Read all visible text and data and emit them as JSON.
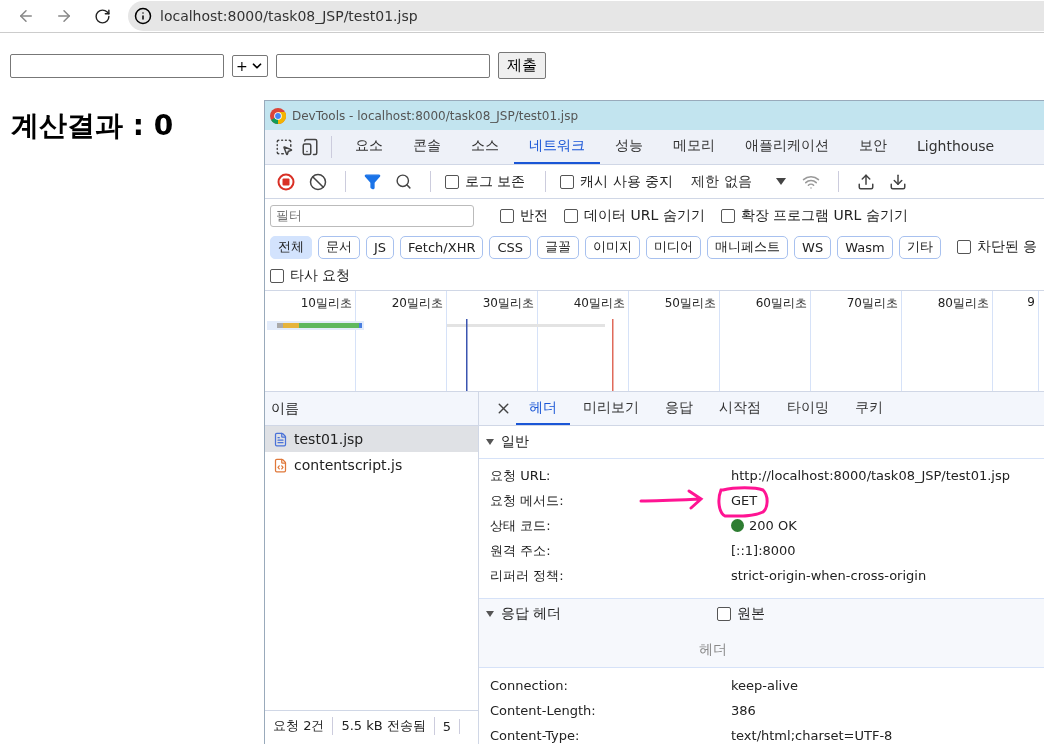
{
  "browser": {
    "url": "localhost:8000/task08_JSP/test01.jsp"
  },
  "form": {
    "operator": "+",
    "submit": "제출"
  },
  "result": "계산결과 : 0",
  "devtools": {
    "title": "DevTools - localhost:8000/task08_JSP/test01.jsp",
    "tabs": [
      {
        "label": "요소",
        "selected": false
      },
      {
        "label": "콘솔",
        "selected": false
      },
      {
        "label": "소스",
        "selected": false
      },
      {
        "label": "네트워크",
        "selected": true
      },
      {
        "label": "성능",
        "selected": false
      },
      {
        "label": "메모리",
        "selected": false
      },
      {
        "label": "애플리케이션",
        "selected": false
      },
      {
        "label": "보안",
        "selected": false
      },
      {
        "label": "Lighthouse",
        "selected": false
      }
    ],
    "toolbar": {
      "checks": [
        {
          "label": "로그 보존",
          "checked": false
        },
        {
          "label": "캐시 사용 중지",
          "checked": false
        }
      ],
      "throttle": "제한 없음"
    },
    "filter": {
      "placeholder": "필터",
      "checks": [
        {
          "label": "반전",
          "checked": false
        },
        {
          "label": "데이터 URL 숨기기",
          "checked": false
        },
        {
          "label": "확장 프로그램 URL 숨기기",
          "checked": false
        }
      ]
    },
    "types": [
      {
        "label": "전체",
        "selected": true
      },
      {
        "label": "문서",
        "selected": false
      },
      {
        "label": "JS",
        "selected": false
      },
      {
        "label": "Fetch/XHR",
        "selected": false
      },
      {
        "label": "CSS",
        "selected": false
      },
      {
        "label": "글꼴",
        "selected": false
      },
      {
        "label": "이미지",
        "selected": false
      },
      {
        "label": "미디어",
        "selected": false
      },
      {
        "label": "매니페스트",
        "selected": false
      },
      {
        "label": "WS",
        "selected": false
      },
      {
        "label": "Wasm",
        "selected": false
      },
      {
        "label": "기타",
        "selected": false
      }
    ],
    "blocked": {
      "label": "차단된 응",
      "checked": false
    },
    "third_party": {
      "label": "타사 요청",
      "checked": false
    },
    "timeline": {
      "ticks": [
        "10밀리초",
        "20밀리초",
        "30밀리초",
        "40밀리초",
        "50밀리초",
        "60밀리초",
        "70밀리초",
        "80밀리초",
        "9"
      ]
    },
    "requests": {
      "header": "이름",
      "items": [
        {
          "name": "test01.jsp",
          "kind": "document",
          "selected": true
        },
        {
          "name": "contentscript.js",
          "kind": "script",
          "selected": false
        }
      ]
    },
    "status": [
      "요청 2건",
      "5.5 kB 전송됨",
      "5"
    ],
    "detail_tabs": [
      {
        "label": "헤더",
        "selected": true
      },
      {
        "label": "미리보기",
        "selected": false
      },
      {
        "label": "응답",
        "selected": false
      },
      {
        "label": "시작점",
        "selected": false
      },
      {
        "label": "타이밍",
        "selected": false
      },
      {
        "label": "쿠키",
        "selected": false
      }
    ],
    "general": {
      "title": "일반",
      "expanded": true,
      "rows": [
        {
          "name": "요청 URL:",
          "value": "http://localhost:8000/task08_JSP/test01.jsp",
          "kind": "text"
        },
        {
          "name": "요청 메서드:",
          "value": "GET",
          "kind": "text"
        },
        {
          "name": "상태 코드:",
          "value": "200 OK",
          "kind": "status"
        },
        {
          "name": "원격 주소:",
          "value": "[::1]:8000",
          "kind": "text"
        },
        {
          "name": "리퍼러 정책:",
          "value": "strict-origin-when-cross-origin",
          "kind": "text"
        }
      ]
    },
    "response_headers": {
      "title": "응답 헤더",
      "expanded": true,
      "raw": {
        "label": "원본",
        "checked": false
      },
      "hint": "헤더",
      "rows": [
        {
          "name": "Connection:",
          "value": "keep-alive",
          "kind": "text"
        },
        {
          "name": "Content-Length:",
          "value": "386",
          "kind": "text"
        },
        {
          "name": "Content-Type:",
          "value": "text/html;charset=UTF-8",
          "kind": "text"
        }
      ]
    }
  }
}
